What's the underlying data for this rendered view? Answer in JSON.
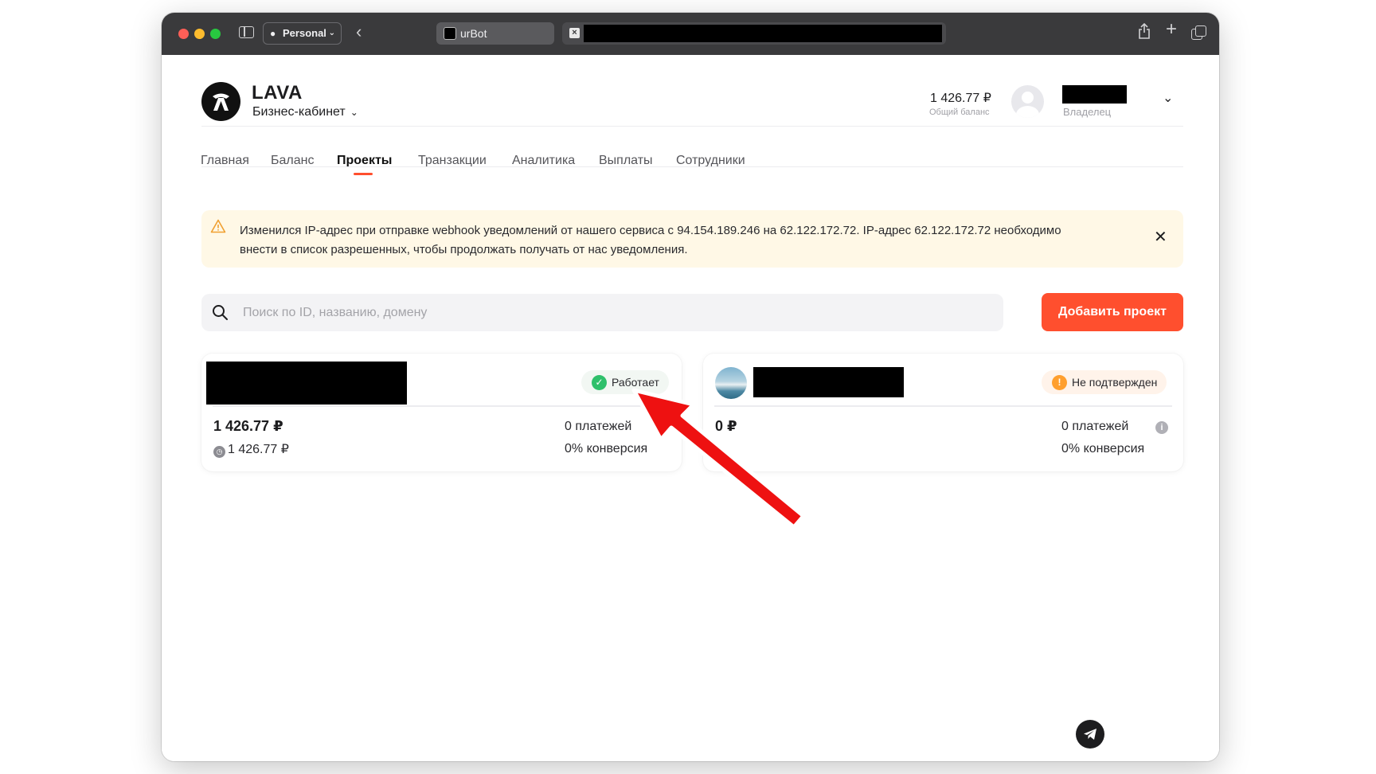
{
  "browser": {
    "profile_label": "Personal",
    "tabs": [
      {
        "label": "urBot"
      }
    ]
  },
  "header": {
    "brand": "LAVA",
    "cabinet_label": "Бизнес-кабинет",
    "balance_value": "1 426.77 ₽",
    "balance_label": "Общий баланс",
    "role": "Владелец"
  },
  "nav": {
    "items": [
      {
        "label": "Главная"
      },
      {
        "label": "Баланс"
      },
      {
        "label": "Проекты"
      },
      {
        "label": "Транзакции"
      },
      {
        "label": "Аналитика"
      },
      {
        "label": "Выплаты"
      },
      {
        "label": "Сотрудники"
      }
    ],
    "active": "Проекты"
  },
  "alert": {
    "message": "Изменился IP-адрес при отправке webhook уведомлений от нашего сервиса с 94.154.189.246 на 62.122.172.72. IP-адрес 62.122.172.72 необходимо внести в список разрешенных, чтобы продолжать получать от нас уведомления."
  },
  "search": {
    "placeholder": "Поиск по ID, названию, домену",
    "value": ""
  },
  "add_project_label": "Добавить проект",
  "projects": [
    {
      "status": "Работает",
      "amount": "1 426.77 ₽",
      "sub_amount": "1 426.77 ₽",
      "payments": "0 платежей",
      "conversion": "0% конверсия"
    },
    {
      "status": "Не подтвержден",
      "amount": "0 ₽",
      "payments": "0 платежей",
      "conversion": "0% конверсия"
    }
  ],
  "colors": {
    "accent": "#ff4f2e",
    "ok": "#2fc06b",
    "warn": "#ff9f2e",
    "alert_bg": "#fff8e6",
    "annotation_arrow": "#ee1111"
  }
}
